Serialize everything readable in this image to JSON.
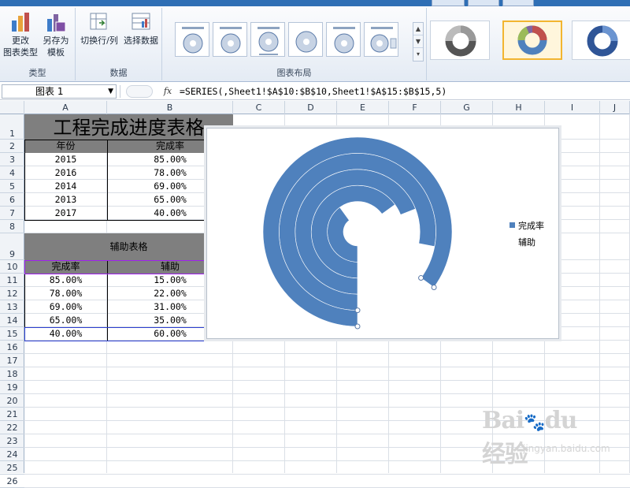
{
  "ribbon": {
    "groups": {
      "type": {
        "label": "类型",
        "buttons": [
          "更改\n图表类型",
          "另存为\n模板"
        ]
      },
      "data": {
        "label": "数据",
        "buttons": [
          "切换行/列",
          "选择数据"
        ]
      },
      "layout": {
        "label": "图表布局"
      }
    },
    "change_type_line1": "更改",
    "change_type_line2": "图表类型",
    "save_template_line1": "另存为",
    "save_template_line2": "模板",
    "switch_row_col": "切换行/列",
    "select_data": "选择数据"
  },
  "formula_bar": {
    "name_box": "图表 1",
    "fx": "fx",
    "formula": "=SERIES(,Sheet1!$A$10:$B$10,Sheet1!$A$15:$B$15,5)"
  },
  "columns": [
    "A",
    "B",
    "C",
    "D",
    "E",
    "F",
    "G",
    "H",
    "I",
    "J"
  ],
  "rows": [
    "1",
    "2",
    "3",
    "4",
    "5",
    "6",
    "7",
    "8",
    "9",
    "10",
    "11",
    "12",
    "13",
    "14",
    "15",
    "16",
    "17",
    "18",
    "19",
    "20",
    "21",
    "22",
    "23",
    "24",
    "25",
    "26"
  ],
  "sheet": {
    "title": "工程完成进度表格",
    "header": [
      "年份",
      "完成率"
    ],
    "rows": [
      [
        "2015",
        "85.00%"
      ],
      [
        "2016",
        "78.00%"
      ],
      [
        "2014",
        "69.00%"
      ],
      [
        "2013",
        "65.00%"
      ],
      [
        "2017",
        "40.00%"
      ]
    ],
    "aux_title": "辅助表格",
    "aux_header": [
      "完成率",
      "辅助"
    ],
    "aux_rows": [
      [
        "85.00%",
        "15.00%"
      ],
      [
        "78.00%",
        "22.00%"
      ],
      [
        "69.00%",
        "31.00%"
      ],
      [
        "65.00%",
        "35.00%"
      ],
      [
        "40.00%",
        "60.00%"
      ]
    ]
  },
  "chart": {
    "legend": [
      "完成率",
      "辅助"
    ],
    "colors": {
      "series1": "#4f81bd",
      "series2": "#ffffff"
    }
  },
  "chart_data": {
    "type": "doughnut",
    "rings_inner_to_outer": [
      "2017",
      "2013",
      "2014",
      "2016",
      "2015"
    ],
    "series": [
      {
        "name": "完成率",
        "values": [
          0.4,
          0.65,
          0.69,
          0.78,
          0.85
        ]
      },
      {
        "name": "辅助",
        "values": [
          0.6,
          0.35,
          0.31,
          0.22,
          0.15
        ]
      }
    ],
    "start_angle_deg": 180,
    "legend_position": "right"
  },
  "watermark": {
    "logo": "Baidu经验",
    "url": "jingyan.baidu.com"
  }
}
